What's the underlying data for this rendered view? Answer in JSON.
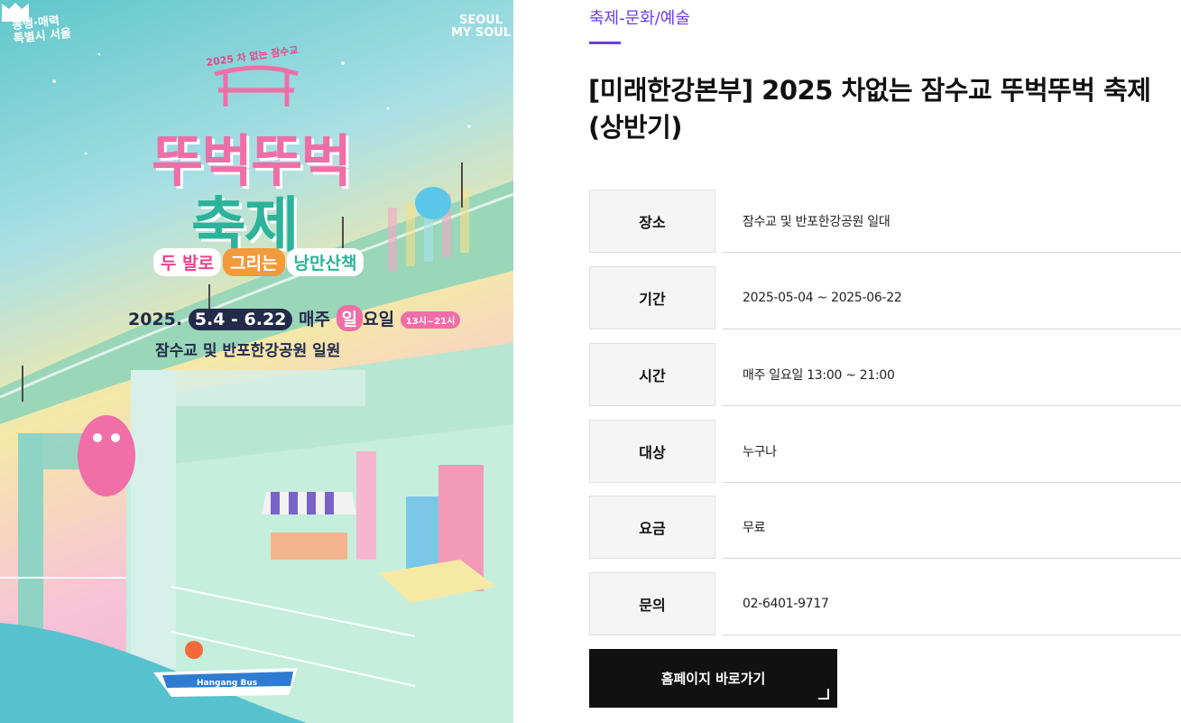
{
  "category": "축제-문화/예술",
  "title": "[미래한강본부] 2025 차없는 잠수교 뚜벅뚜벅 축제 (상반기)",
  "info": [
    {
      "label": "장소",
      "value": "잠수교 및 반포한강공원 일대"
    },
    {
      "label": "기간",
      "value": "2025-05-04 ~ 2025-06-22"
    },
    {
      "label": "시간",
      "value": "매주 일요일 13:00 ~ 21:00"
    },
    {
      "label": "대상",
      "value": "누구나"
    },
    {
      "label": "요금",
      "value": "무료"
    },
    {
      "label": "문의",
      "value": "02-6401-9717"
    }
  ],
  "homepage_button": "홈페이지 바로가기",
  "poster": {
    "slogan_line1": "동행·매력",
    "slogan_line2": "특별시 서울",
    "seoul_logo_line1": "SEOUL",
    "seoul_logo_line2": "MY SOUL",
    "subtitle": "2025 차 없는 잠수교",
    "title_line1": "뚜벅뚜벅",
    "title_line2": "축제",
    "tagline_1": "두 발로",
    "tagline_2": "그리는",
    "tagline_3": "낭만산책",
    "date_year": "2025.",
    "date_range": "5.4 - 6.22",
    "date_every": "매주",
    "date_day": "일",
    "date_day_suffix": "요일",
    "date_time": "13시~21시",
    "place": "잠수교 및 반포한강공원 일원",
    "bus_label": "Hangang Bus"
  },
  "colors": {
    "accent": "#6a3df0",
    "button_bg": "#111111",
    "label_bg": "#f5f5f5"
  }
}
